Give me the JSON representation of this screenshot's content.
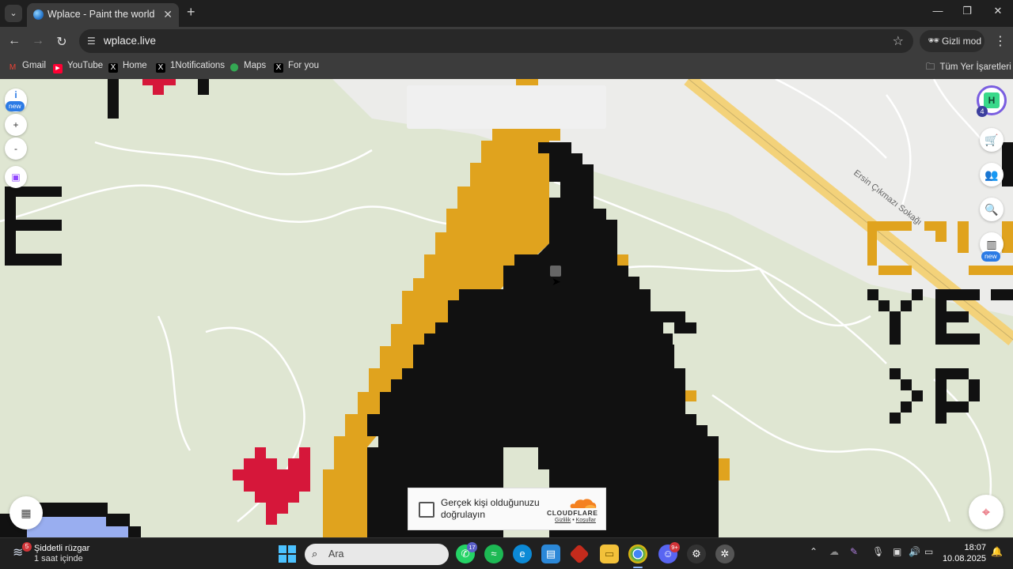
{
  "browser": {
    "tab_title": "Wplace - Paint the world",
    "url": "wplace.live",
    "incognito_label": "Gizli mod",
    "all_bookmarks_label": "Tüm Yer İşaretleri",
    "bookmarks": [
      {
        "label": "Gmail",
        "icon": "gmail-icon",
        "color": "#ea4335"
      },
      {
        "label": "YouTube",
        "icon": "youtube-icon",
        "color": "#ff0033"
      },
      {
        "label": "Home",
        "icon": "x-icon",
        "color": "#000000"
      },
      {
        "label": "1Notifications",
        "icon": "x-icon",
        "color": "#000000"
      },
      {
        "label": "Maps",
        "icon": "maps-icon",
        "color": "#34a853"
      },
      {
        "label": "For you",
        "icon": "x-icon",
        "color": "#000000"
      }
    ]
  },
  "map": {
    "left_controls": {
      "info_label": "i",
      "new_badge": "new",
      "zoom_in": "+",
      "zoom_out": "-"
    },
    "right_controls": {
      "level": "4",
      "new_badge": "new"
    },
    "street_label": "Ersin Çıkmazı Sokağı",
    "colors": {
      "land": "#dfe6d2",
      "road": "#ffffff",
      "highway": "#f3d27a",
      "black_pixels": "#111111",
      "gold_pixels": "#e0a31e",
      "red_pixels": "#d6173a",
      "blue_pixels": "#99aef0"
    }
  },
  "captcha": {
    "label": "Gerçek kişi olduğunuzu doğrulayın",
    "brand": "CLOUDFLARE",
    "privacy": "Gizlilik",
    "separator": "•",
    "terms": "Koşullar"
  },
  "taskbar": {
    "weather_title": "Şiddetli rüzgar",
    "weather_sub": "1 saat içinde",
    "weather_badge": "5",
    "search_placeholder": "Ara",
    "whatsapp_badge": "17",
    "discord_badge": "9+",
    "time": "18:07",
    "date": "10.08.2025"
  }
}
